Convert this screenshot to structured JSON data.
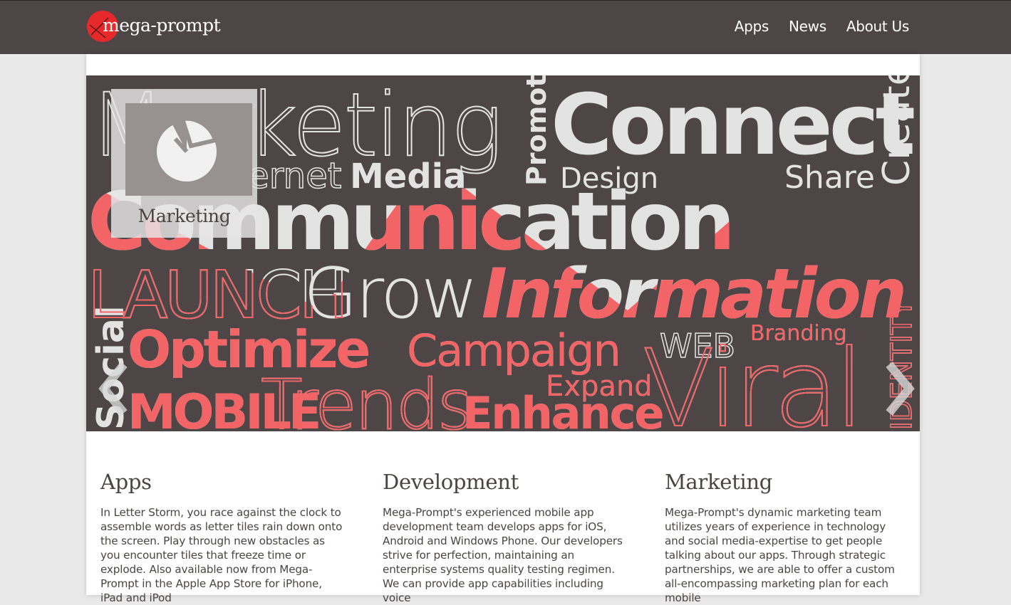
{
  "header": {
    "logo_text": "mega-prompt",
    "nav": [
      {
        "label": "Apps"
      },
      {
        "label": "News"
      },
      {
        "label": "About Us"
      }
    ]
  },
  "colors": {
    "header_bg": "#4e4646",
    "accent": "#f26465",
    "word_light": "#e3e3e3",
    "logo_red": "#e8292c"
  },
  "hero": {
    "caption": "Marketing",
    "caption_icon": "pie-chart-icon",
    "prev_icon": "chevron-left-icon",
    "next_icon": "chevron-right-icon",
    "words": [
      "Marketing",
      "Connect",
      "Promote",
      "Create",
      "Media",
      "Design",
      "Share",
      "Internet",
      "Communication",
      "LAUNCH",
      "Grow",
      "Information",
      "Social",
      "Optimize",
      "Campaign",
      "WEB",
      "Branding",
      "Viral",
      "IDENTITY",
      "MOBILE",
      "Trends",
      "Expand",
      "Enhance"
    ]
  },
  "columns": [
    {
      "title": "Apps",
      "text": "In Letter Storm, you race against the clock to assemble words as letter tiles rain down onto the screen. Play through new obstacles as you encounter tiles that freeze time or explode. Also available now from Mega-Prompt in the Apple App Store for iPhone, iPad and iPod"
    },
    {
      "title": "Development",
      "text": "Mega-Prompt's experienced mobile app development team develops apps for iOS, Android and Windows Phone. Our developers strive for perfection, maintaining an enterprise systems quality testing regimen. We can provide app capabilities including voice"
    },
    {
      "title": "Marketing",
      "text": "Mega-Prompt's dynamic marketing team utilizes years of experience in technology and social media-expertise to get people talking about our apps. Through strategic partnerships, we are able to offer a custom all-encompassing marketing plan for each mobile"
    }
  ]
}
